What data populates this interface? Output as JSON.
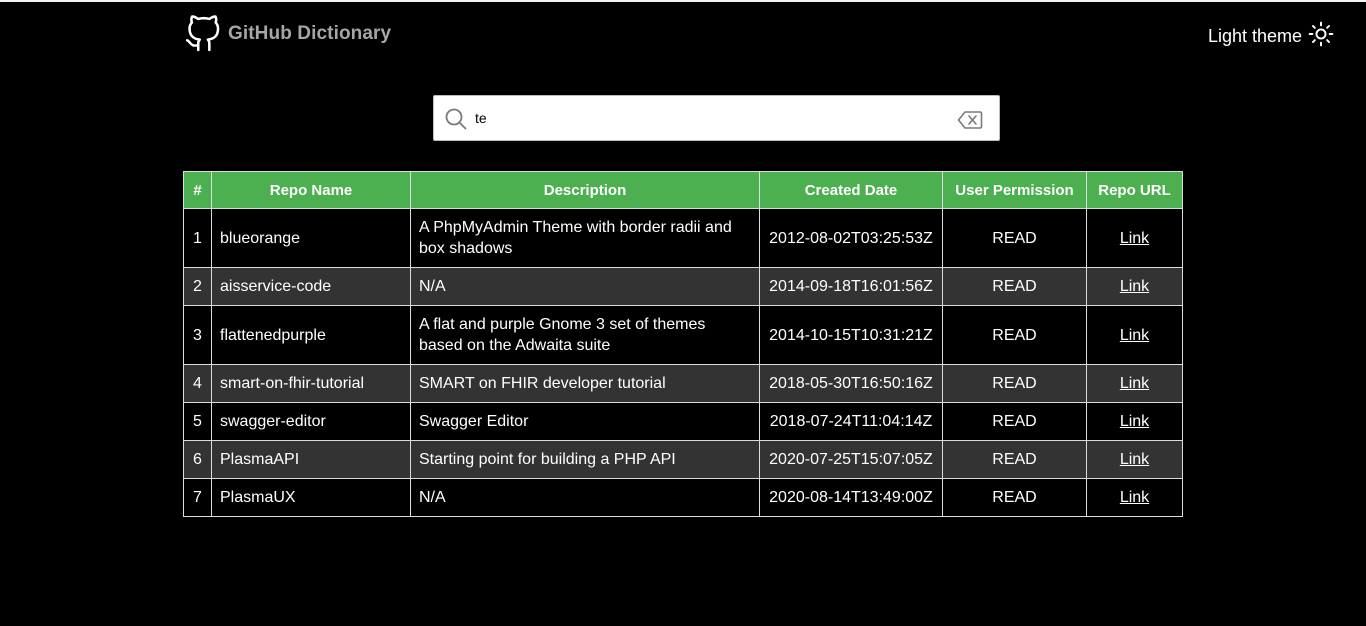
{
  "header": {
    "title": "GitHub Dictionary",
    "logo_icon": "github-octocat-icon",
    "theme_toggle_label": "Light theme",
    "theme_icon": "sun-icon"
  },
  "search": {
    "value": "te",
    "placeholder": "",
    "search_icon": "search-icon",
    "clear_icon": "backspace-clear-icon"
  },
  "table": {
    "header_color": "#4caf50",
    "columns": [
      "#",
      "Repo Name",
      "Description",
      "Created Date",
      "User Permission",
      "Repo URL"
    ],
    "rows": [
      {
        "num": "1",
        "name": "blueorange",
        "description": "A PhpMyAdmin Theme with border radii and box shadows",
        "created": "2012-08-02T03:25:53Z",
        "permission": "READ",
        "url_label": "Link"
      },
      {
        "num": "2",
        "name": "aisservice-code",
        "description": "N/A",
        "created": "2014-09-18T16:01:56Z",
        "permission": "READ",
        "url_label": "Link"
      },
      {
        "num": "3",
        "name": "flattenedpurple",
        "description": "A flat and purple Gnome 3 set of themes based on the Adwaita suite",
        "created": "2014-10-15T10:31:21Z",
        "permission": "READ",
        "url_label": "Link"
      },
      {
        "num": "4",
        "name": "smart-on-fhir-tutorial",
        "description": "SMART on FHIR developer tutorial",
        "created": "2018-05-30T16:50:16Z",
        "permission": "READ",
        "url_label": "Link"
      },
      {
        "num": "5",
        "name": "swagger-editor",
        "description": "Swagger Editor",
        "created": "2018-07-24T11:04:14Z",
        "permission": "READ",
        "url_label": "Link"
      },
      {
        "num": "6",
        "name": "PlasmaAPI",
        "description": "Starting point for building a PHP API",
        "created": "2020-07-25T15:07:05Z",
        "permission": "READ",
        "url_label": "Link"
      },
      {
        "num": "7",
        "name": "PlasmaUX",
        "description": "N/A",
        "created": "2020-08-14T13:49:00Z",
        "permission": "READ",
        "url_label": "Link"
      }
    ]
  }
}
